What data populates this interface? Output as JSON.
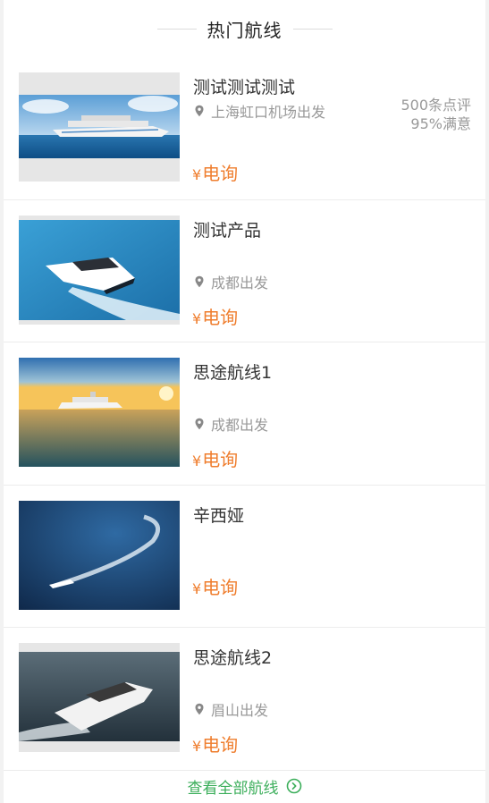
{
  "section": {
    "title": "热门航线"
  },
  "currency": "¥",
  "routes": [
    {
      "name": "测试测试测试",
      "location": "上海虹口机场出发",
      "price": "电询",
      "reviews": "500条点评",
      "satisfaction": "95%满意",
      "image": "cruise-ship"
    },
    {
      "name": "测试产品",
      "location": "成都出发",
      "price": "电询",
      "image": "yacht-ocean"
    },
    {
      "name": "思途航线1",
      "location": "成都出发",
      "price": "电询",
      "image": "ferry-sunset"
    },
    {
      "name": "辛西娅",
      "location": "",
      "price": "电询",
      "image": "yacht-wake-circle"
    },
    {
      "name": "思途航线2",
      "location": "眉山出发",
      "price": "电询",
      "image": "yacht-cruising"
    }
  ],
  "footer": {
    "view_all": "查看全部航线",
    "icon": "chevron-right-circle-icon"
  },
  "colors": {
    "price": "#ef7d2d",
    "link": "#3bae5a",
    "muted": "#999999"
  }
}
